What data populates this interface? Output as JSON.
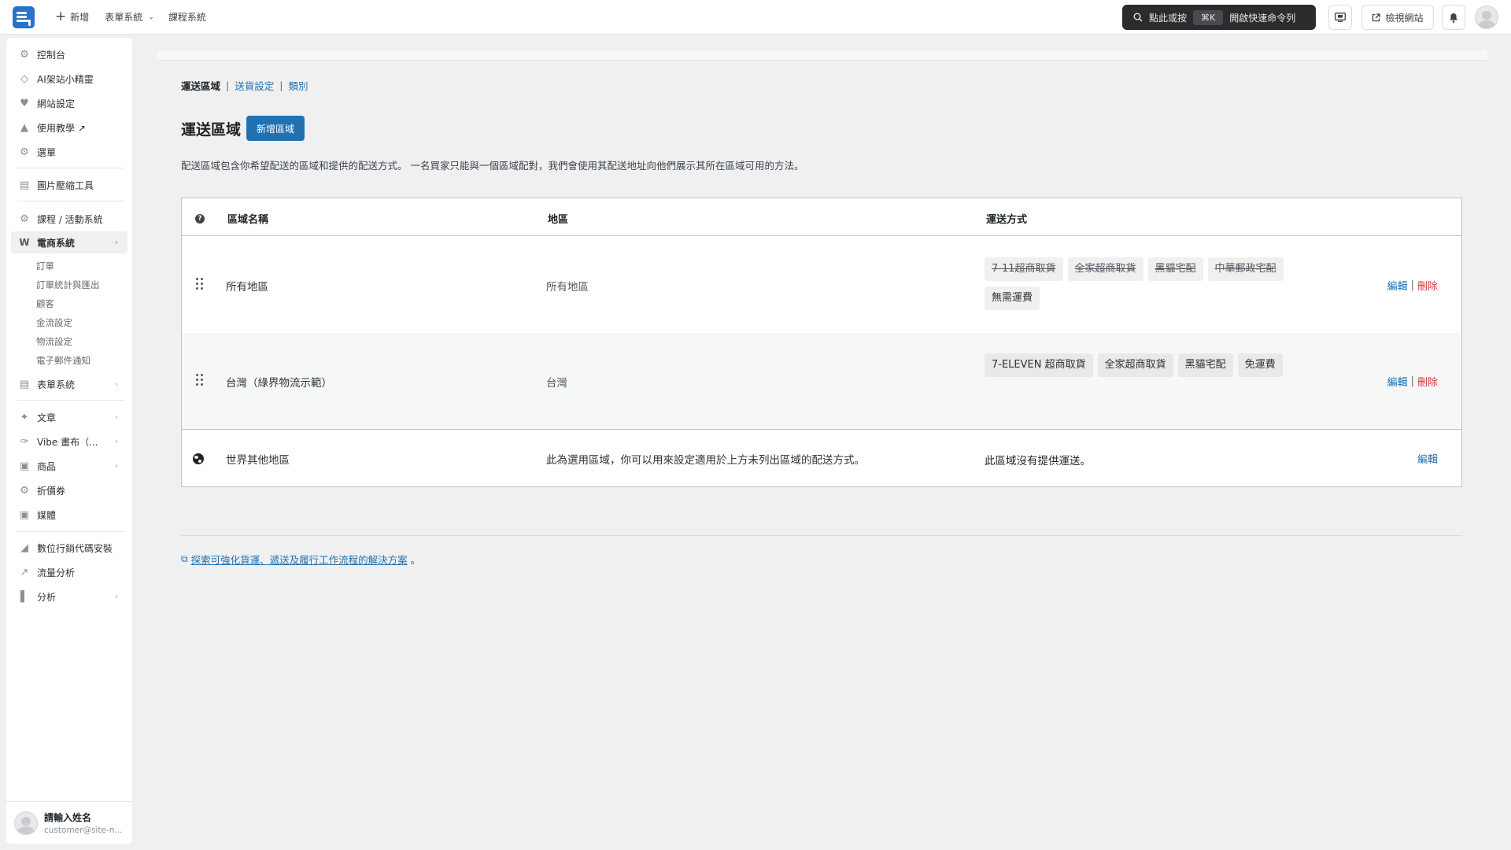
{
  "topbar": {
    "new_label": "新增",
    "forms_label": "表單系統",
    "courses_label": "課程系統",
    "command": {
      "prefix": "點此或按",
      "shortcut": "⌘K",
      "suffix": "開啟快速命令列"
    },
    "visit_site_label": "檢視網站"
  },
  "sidebar": {
    "items": [
      {
        "label": "控制台",
        "icon": "dashboard-icon"
      },
      {
        "label": "AI架站小精靈",
        "icon": "ai-diamond-icon"
      },
      {
        "label": "網站設定",
        "icon": "heart-icon"
      },
      {
        "label": "使用教學 ↗",
        "icon": "graduation-cap-icon"
      },
      {
        "label": "選單",
        "icon": "gear-icon"
      },
      {
        "label": "圖片壓縮工具",
        "icon": "image-compress-icon"
      },
      {
        "label": "課程 / 活動系統",
        "icon": "gear-icon"
      },
      {
        "label": "電商系統",
        "icon": "woo-icon"
      },
      {
        "label": "表單系統",
        "icon": "form-icon"
      },
      {
        "label": "文章",
        "icon": "pin-icon"
      },
      {
        "label": "Vibe 畫布（...",
        "icon": "brush-icon"
      },
      {
        "label": "商品",
        "icon": "archive-icon"
      },
      {
        "label": "折價券",
        "icon": "gear-icon"
      },
      {
        "label": "媒體",
        "icon": "media-icon"
      },
      {
        "label": "數位行銷代碼安裝",
        "icon": "chart-icon"
      },
      {
        "label": "流量分析",
        "icon": "line-chart-icon"
      },
      {
        "label": "分析",
        "icon": "bar-chart-icon"
      }
    ],
    "ecommerce_sub": [
      "訂單",
      "訂單統計與匯出",
      "顧客",
      "金流設定",
      "物流設定",
      "電子郵件通知"
    ],
    "user": {
      "name": "請輸入姓名",
      "email": "customer@site-n..."
    }
  },
  "subnav": {
    "current": "運送區域",
    "links": [
      "送貨設定",
      "類別"
    ]
  },
  "page": {
    "title": "運送區域",
    "add_button": "新增區域",
    "description": "配送區域包含你希望配送的區域和提供的配送方式。 一名買家只能與一個區域配對，我們會使用其配送地址向他們展示其所在區域可用的方法。"
  },
  "table": {
    "headers": [
      "區域名稱",
      "地區",
      "運送方式"
    ],
    "rows": [
      {
        "name": "所有地區",
        "region": "所有地區",
        "methods": [
          {
            "label": "7-11超商取貨",
            "disabled": true
          },
          {
            "label": "全家超商取貨",
            "disabled": true
          },
          {
            "label": "黑貓宅配",
            "disabled": true
          },
          {
            "label": "中華郵政宅配",
            "disabled": true
          },
          {
            "label": "無需運費",
            "disabled": false
          }
        ],
        "edit": "編輯",
        "delete": "刪除"
      },
      {
        "name": "台灣（綠界物流示範）",
        "region": "台灣",
        "methods": [
          {
            "label": "7-ELEVEN 超商取貨",
            "disabled": false
          },
          {
            "label": "全家超商取貨",
            "disabled": false
          },
          {
            "label": "黑貓宅配",
            "disabled": false
          },
          {
            "label": "免運費",
            "disabled": false
          }
        ],
        "edit": "編輯",
        "delete": "刪除"
      }
    ],
    "rest": {
      "name": "世界其他地區",
      "description": "此為選用區域，你可以用來設定適用於上方未列出區域的配送方式。",
      "methods_text": "此區域沒有提供運送。",
      "edit": "編輯"
    }
  },
  "footer": {
    "link_text": "探索可強化貨運、遞送及履行工作流程的解決方案",
    "trailing": "。"
  }
}
